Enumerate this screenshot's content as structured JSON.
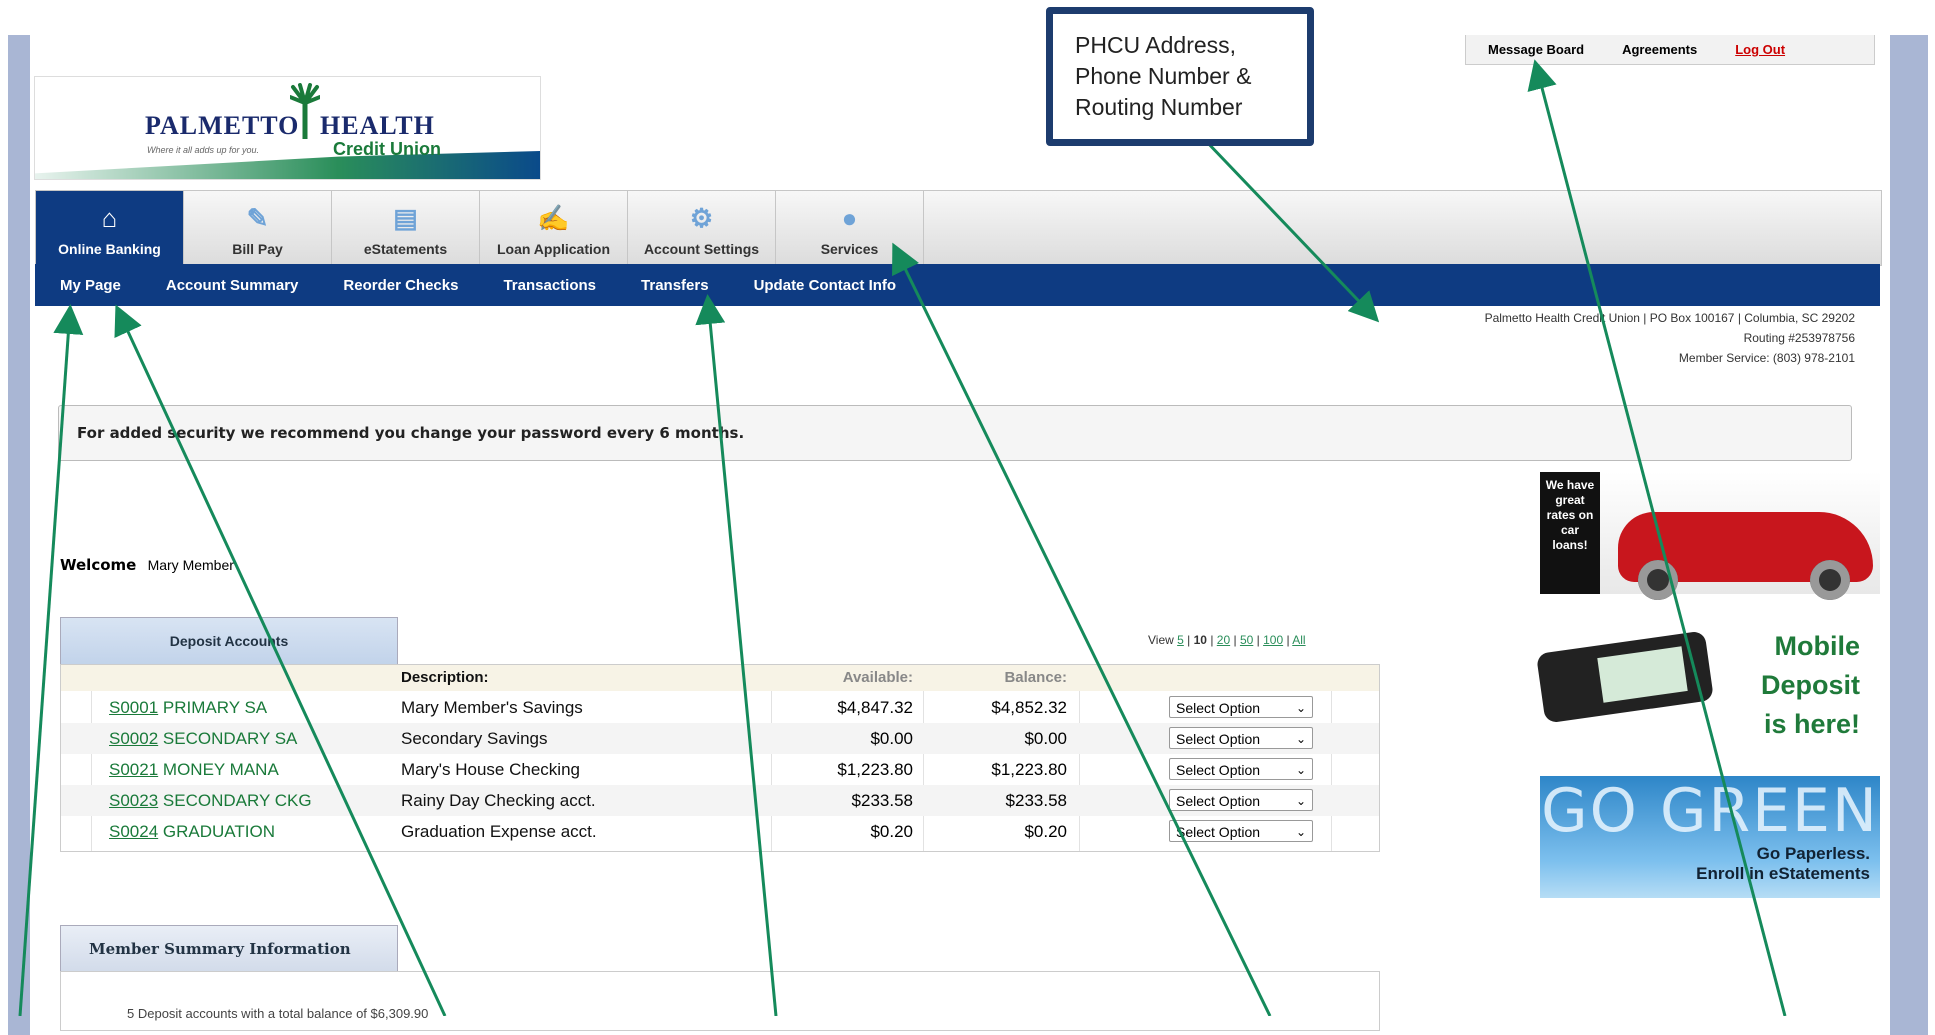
{
  "top_links": [
    "Message Board",
    "Agreements",
    "Log Out"
  ],
  "logo": {
    "name1": "PALMETTO",
    "name2": "HEALTH",
    "tagline": "Where it all adds up for you.",
    "cu": "Credit Union"
  },
  "main_nav": [
    {
      "label": "Online Banking",
      "icon": "home-icon"
    },
    {
      "label": "Bill Pay",
      "icon": "bill-pay-icon"
    },
    {
      "label": "eStatements",
      "icon": "document-icon"
    },
    {
      "label": "Loan Application",
      "icon": "edit-form-icon"
    },
    {
      "label": "Account Settings",
      "icon": "gear-icon"
    },
    {
      "label": "Services",
      "icon": "lightbulb-icon"
    }
  ],
  "sub_nav": [
    "My Page",
    "Account Summary",
    "Reorder Checks",
    "Transactions",
    "Transfers",
    "Update Contact Info"
  ],
  "address": {
    "line1": "Palmetto Health Credit Union | PO Box 100167 | Columbia, SC 29202",
    "line2": "Routing #253978756",
    "line3": "Member Service: (803) 978-2101"
  },
  "notice": "For added security we recommend you change your password every 6 months.",
  "welcome": {
    "label": "Welcome",
    "name": "Mary Member"
  },
  "deposit_tab": "Deposit Accounts",
  "view": {
    "label": "View",
    "options": [
      "5",
      "10",
      "20",
      "50",
      "100",
      "All"
    ],
    "selected": "10"
  },
  "table": {
    "headers": {
      "description": "Description:",
      "available": "Available:",
      "balance": "Balance:"
    },
    "rows": [
      {
        "acct_num": "S0001",
        "acct_name": "PRIMARY SA",
        "desc": "Mary Member's Savings",
        "available": "$4,847.32",
        "balance": "$4,852.32",
        "action": "Select Option"
      },
      {
        "acct_num": "S0002",
        "acct_name": "SECONDARY SA",
        "desc": "Secondary Savings",
        "available": "$0.00",
        "balance": "$0.00",
        "action": "Select Option"
      },
      {
        "acct_num": "S0021",
        "acct_name": "MONEY MANA",
        "desc": "Mary's House Checking",
        "available": "$1,223.80",
        "balance": "$1,223.80",
        "action": "Select Option"
      },
      {
        "acct_num": "S0023",
        "acct_name": "SECONDARY CKG",
        "desc": "Rainy Day Checking acct.",
        "available": "$233.58",
        "balance": "$233.58",
        "action": "Select Option"
      },
      {
        "acct_num": "S0024",
        "acct_name": "GRADUATION",
        "desc": "Graduation Expense acct.",
        "available": "$0.20",
        "balance": "$0.20",
        "action": "Select Option"
      }
    ]
  },
  "member_summary": {
    "tab": "Member Summary Information",
    "text": "5 Deposit accounts with a total balance of $6,309.90"
  },
  "ads": {
    "car": [
      "We have",
      "great",
      "rates on",
      "car",
      "loans!"
    ],
    "mobile": [
      "Mobile",
      "Deposit",
      "is here!"
    ],
    "green": {
      "big": "GO GREEN",
      "line1": "Go Paperless.",
      "line2": "Enroll in eStatements"
    }
  },
  "callout": [
    "PHCU Address,",
    "Phone Number &",
    "Routing Number"
  ],
  "colors": {
    "nav_blue": "#0e3b82",
    "link_green": "#2a8e5a",
    "arrow_green": "#158a5b",
    "callout_border": "#1d3c6e"
  }
}
